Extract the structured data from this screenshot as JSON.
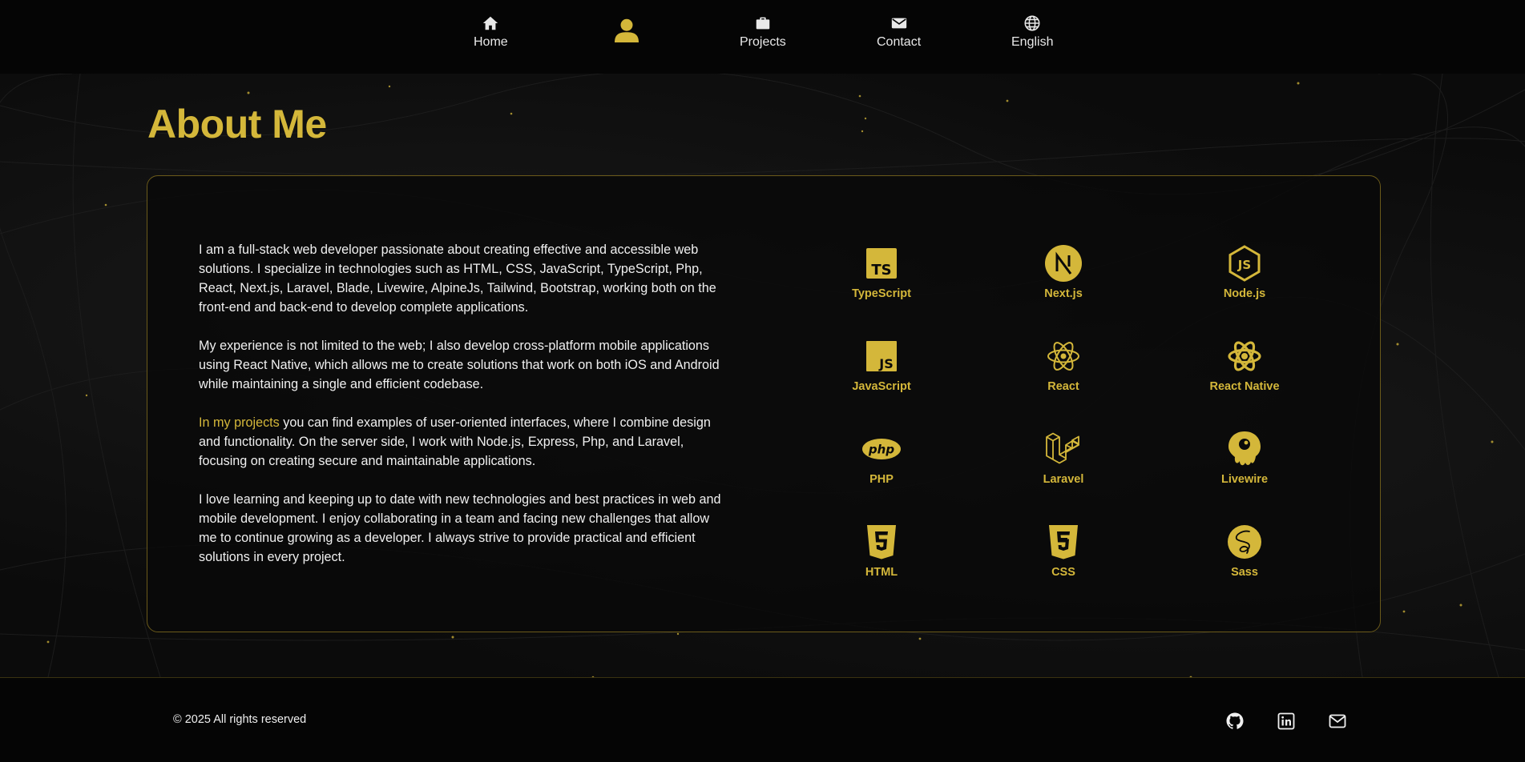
{
  "nav": {
    "items": [
      {
        "label": "Home",
        "icon": "home-icon"
      },
      {
        "label": "",
        "icon": "user-icon"
      },
      {
        "label": "Projects",
        "icon": "briefcase-icon"
      },
      {
        "label": "Contact",
        "icon": "mail-icon"
      },
      {
        "label": "English",
        "icon": "globe-icon"
      }
    ]
  },
  "page": {
    "title": "About Me"
  },
  "about": {
    "p1": "I am a full-stack web developer passionate about creating effective and accessible web solutions. I specialize in technologies such as HTML, CSS, JavaScript, TypeScript, Php, React, Next.js, Laravel, Blade, Livewire, AlpineJs, Tailwind, Bootstrap, working both on the front-end and back-end to develop complete applications.",
    "p2": "My experience is not limited to the web; I also develop cross-platform mobile applications using React Native, which allows me to create solutions that work on both iOS and Android while maintaining a single and efficient codebase.",
    "p3_link": "In my projects",
    "p3_rest": " you can find examples of user-oriented interfaces, where I combine design and functionality. On the server side, I work with Node.js, Express, Php, and Laravel, focusing on creating secure and maintainable applications.",
    "p4": "I love learning and keeping up to date with new technologies and best practices in web and mobile development. I enjoy collaborating in a team and facing new challenges that allow me to continue growing as a developer. I always strive to provide practical and efficient solutions in every project."
  },
  "skills": [
    {
      "name": "TypeScript",
      "icon": "typescript-icon"
    },
    {
      "name": "Next.js",
      "icon": "nextjs-icon"
    },
    {
      "name": "Node.js",
      "icon": "nodejs-icon"
    },
    {
      "name": "JavaScript",
      "icon": "javascript-icon"
    },
    {
      "name": "React",
      "icon": "react-icon"
    },
    {
      "name": "React Native",
      "icon": "react-native-icon"
    },
    {
      "name": "PHP",
      "icon": "php-icon"
    },
    {
      "name": "Laravel",
      "icon": "laravel-icon"
    },
    {
      "name": "Livewire",
      "icon": "livewire-icon"
    },
    {
      "name": "HTML",
      "icon": "html5-icon"
    },
    {
      "name": "CSS",
      "icon": "css3-icon"
    },
    {
      "name": "Sass",
      "icon": "sass-icon"
    }
  ],
  "footer": {
    "copyright": "© 2025 All rights reserved",
    "social": [
      "github-icon",
      "linkedin-icon",
      "email-icon"
    ]
  },
  "colors": {
    "accent": "#d4b73a",
    "background": "#070707",
    "text": "#f0f0f0"
  }
}
